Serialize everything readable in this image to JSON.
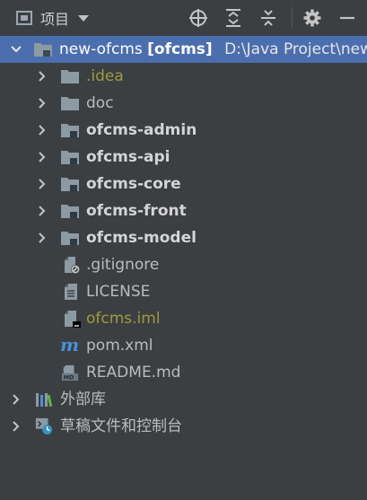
{
  "toolbar": {
    "title": "项目",
    "icons": [
      "locate-icon",
      "expand-all-icon",
      "collapse-all-icon",
      "gear-icon",
      "minimize-icon"
    ]
  },
  "tree": {
    "root": {
      "name": "new-ofcms",
      "module": "[ofcms]",
      "path": "D:\\Java Project\\new"
    },
    "children": [
      {
        "name": ".idea",
        "type": "folder",
        "style": "excluded"
      },
      {
        "name": "doc",
        "type": "folder",
        "style": "normal"
      },
      {
        "name": "ofcms-admin",
        "type": "module",
        "style": "bold"
      },
      {
        "name": "ofcms-api",
        "type": "module",
        "style": "bold"
      },
      {
        "name": "ofcms-core",
        "type": "module",
        "style": "bold"
      },
      {
        "name": "ofcms-front",
        "type": "module",
        "style": "bold"
      },
      {
        "name": "ofcms-model",
        "type": "module",
        "style": "bold"
      },
      {
        "name": ".gitignore",
        "type": "file-ignore",
        "style": "normal"
      },
      {
        "name": "LICENSE",
        "type": "file-text",
        "style": "normal"
      },
      {
        "name": "ofcms.iml",
        "type": "file-iml",
        "style": "excluded"
      },
      {
        "name": "pom.xml",
        "type": "file-maven",
        "style": "normal"
      },
      {
        "name": "README.md",
        "type": "file-md",
        "style": "normal"
      }
    ],
    "external_libraries": "外部库",
    "scratches": "草稿文件和控制台"
  },
  "colors": {
    "background": "#3c3f41",
    "selection": "#4b6eaf",
    "folder": "#8c9aa4",
    "excluded_text": "#9b9b40"
  }
}
